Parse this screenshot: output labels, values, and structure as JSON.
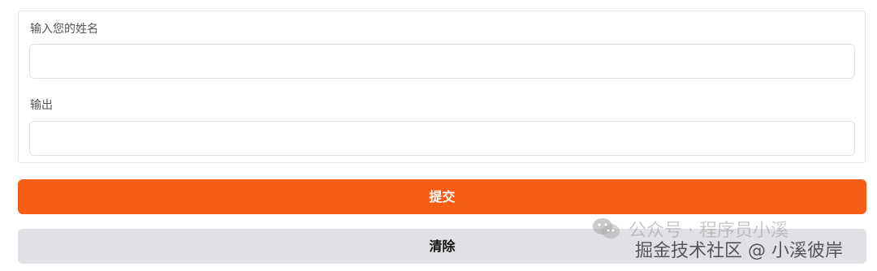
{
  "form": {
    "name_label": "输入您的姓名",
    "name_value": "",
    "output_label": "输出",
    "output_value": ""
  },
  "buttons": {
    "submit_label": "提交",
    "clear_label": "清除"
  },
  "colors": {
    "submit_bg": "#f55d14",
    "clear_bg": "#e1e1e5",
    "border": "#e5e5e5"
  },
  "watermark": {
    "line1": "公众号 · 程序员小溪",
    "line2": "掘金技术社区 @ 小溪彼岸",
    "icon": "wechat-icon"
  }
}
